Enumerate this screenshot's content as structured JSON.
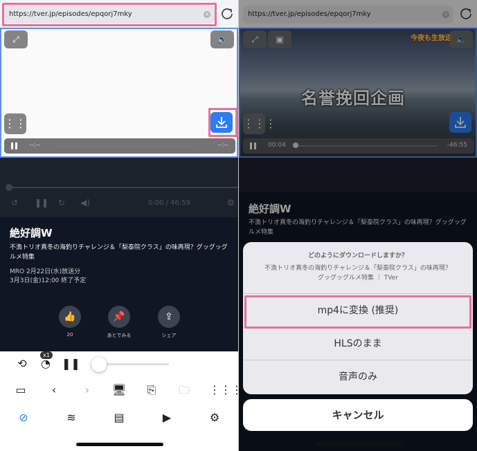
{
  "left": {
    "url": "https://tver.jp/episodes/epqorj7mky",
    "player": {
      "time_current": "--:--",
      "time_total": "--:--"
    },
    "page_player": {
      "time": "0:00 / 46:59"
    },
    "program": {
      "title": "絶好調W",
      "description": "不漁トリオ真冬の海釣りチャレンジ＆「梨泰院クラス」の味再現？グッグッグルメ特集",
      "broadcast": "MRO 2月22日(水)放送分",
      "expiry": "3月3日(金)12:00 終了予定"
    },
    "actions": [
      {
        "name": "like",
        "label": "20",
        "icon": "thumbs-up-icon"
      },
      {
        "name": "watch-later",
        "label": "あとでみる",
        "icon": "pin-icon"
      },
      {
        "name": "share",
        "label": "シェア",
        "icon": "share-icon"
      }
    ],
    "speed_badge": "x1"
  },
  "right": {
    "url": "https://tver.jp/episodes/epqorj7mky",
    "player": {
      "time_current": "00:04",
      "time_total": "-46:55"
    },
    "video_caption": "名誉挽回企画",
    "video_logo": "今夜も生放送",
    "program": {
      "title": "絶好調W",
      "description": "不漁トリオ真冬の海釣りチャレンジ＆「梨泰院クラス」の味再現？グッグッグルメ特集"
    },
    "sheet": {
      "question": "どのようにダウンロードしますか？",
      "subtitle_line1": "不漁トリオ真冬の海釣りチャレンジ＆「梨泰院クラス」の味再現？",
      "subtitle_line2": "グッグッグルメ特集 ｜ TVer",
      "options": [
        "mp4に変換 (推奨)",
        "HLSのまま",
        "音声のみ"
      ],
      "cancel": "キャンセル"
    }
  },
  "colors": {
    "accent": "#2d7cf4",
    "highlight": "#e8709a",
    "page_bg": "#0f1724"
  }
}
